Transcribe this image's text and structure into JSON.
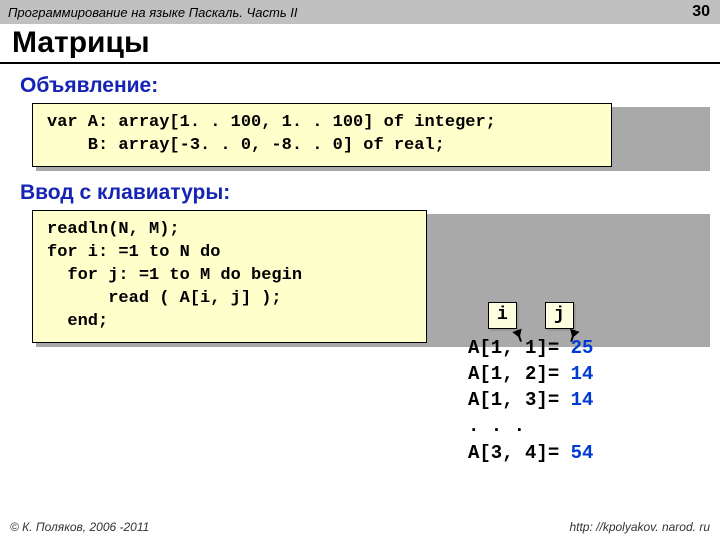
{
  "header": {
    "title": "Программирование на языке Паскаль. Часть II",
    "page": "30"
  },
  "main_title": "Матрицы",
  "sections": {
    "decl_label": "Объявление:",
    "decl_code": "var A: array[1. . 100, 1. . 100] of integer;\n    B: array[-3. . 0, -8. . 0] of real;",
    "input_label": "Ввод с клавиатуры:",
    "input_code": "readln(N, M);\nfor i: =1 to N do\n  for j: =1 to M do begin\n      read ( A[i, j] );\n  end;"
  },
  "vars": {
    "i": "i",
    "j": "j"
  },
  "rows": [
    {
      "lhs": "A[1, 1]=",
      "val": "25"
    },
    {
      "lhs": "A[1, 2]=",
      "val": "14"
    },
    {
      "lhs": "A[1, 3]=",
      "val": "14"
    },
    {
      "lhs": "  . . .",
      "val": ""
    },
    {
      "lhs": "A[3, 4]=",
      "val": "54"
    }
  ],
  "footer": {
    "left": "© К. Поляков, 2006 -2011",
    "right": "http: //kpolyakov. narod. ru"
  }
}
